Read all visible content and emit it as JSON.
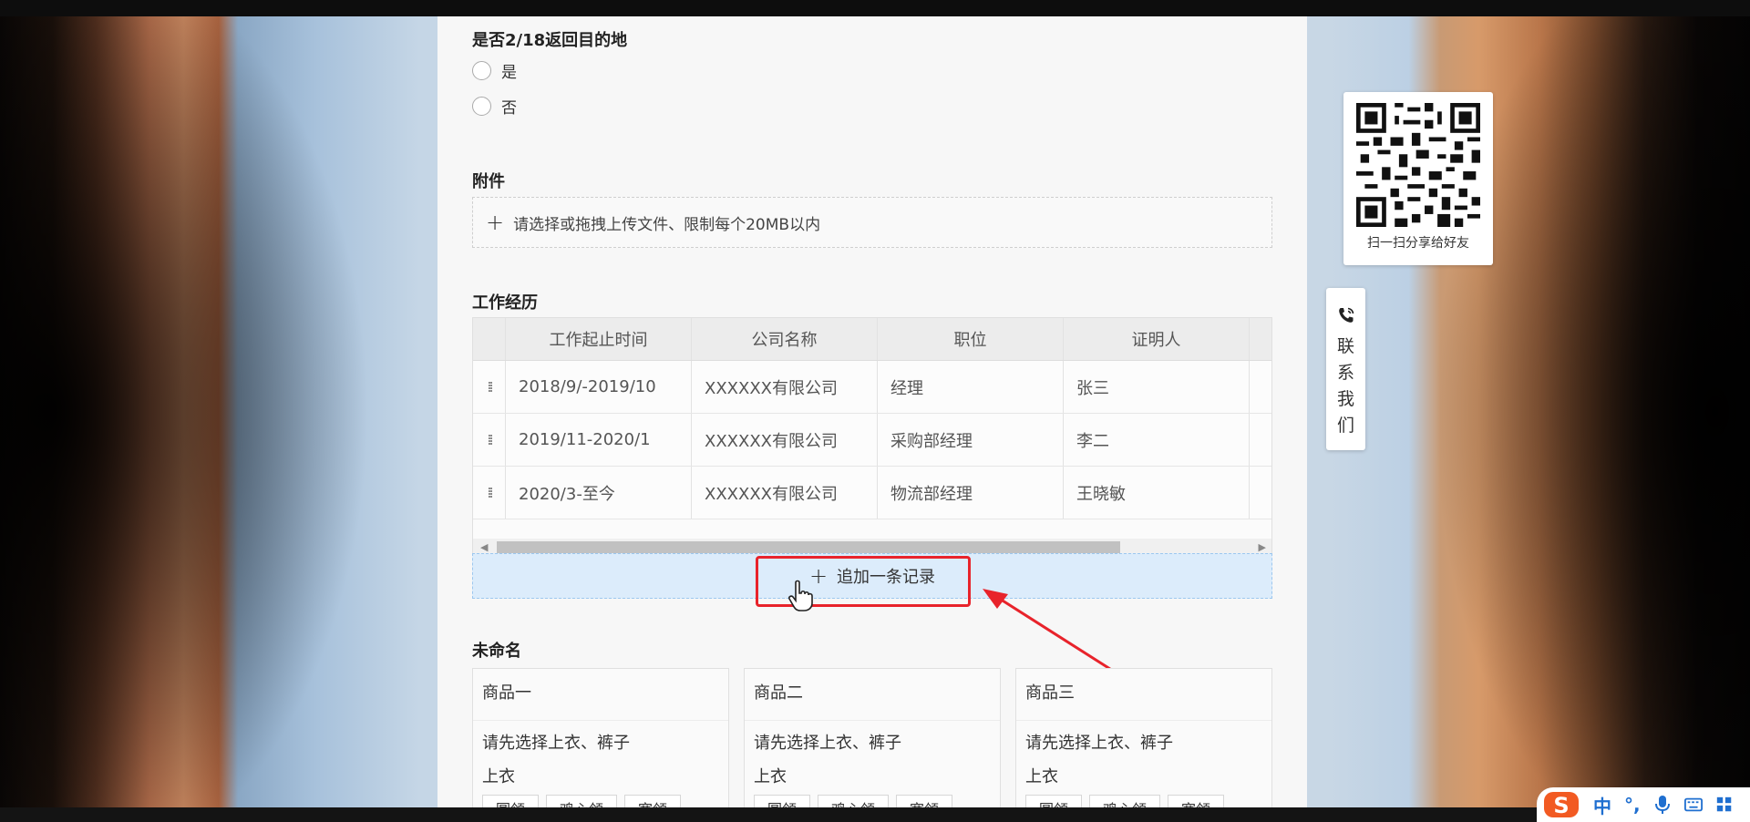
{
  "form": {
    "question_title": "是否2/18返回目的地",
    "options": [
      "是",
      "否"
    ],
    "attachment": {
      "title": "附件",
      "upload_hint": "请选择或拖拽上传文件、限制每个20MB以内"
    },
    "work_history": {
      "title": "工作经历",
      "columns": [
        "工作起止时间",
        "公司名称",
        "职位",
        "证明人"
      ],
      "rows": [
        [
          "2018/9/-2019/10",
          "XXXXXX有限公司",
          "经理",
          "张三"
        ],
        [
          "2019/11-2020/1",
          "XXXXXX有限公司",
          "采购部经理",
          "李二"
        ],
        [
          "2020/3-至今",
          "XXXXXX有限公司",
          "物流部经理",
          "王晓敏"
        ]
      ],
      "add_record_label": "追加一条记录"
    },
    "unnamed": {
      "title": "未命名",
      "cards": [
        {
          "title": "商品一",
          "hint": "请先选择上衣、裤子",
          "sub": "上衣",
          "chips": [
            "圆领",
            "鸡心领",
            "宽领"
          ]
        },
        {
          "title": "商品二",
          "hint": "请先选择上衣、裤子",
          "sub": "上衣",
          "chips": [
            "圆领",
            "鸡心领",
            "宽领"
          ]
        },
        {
          "title": "商品三",
          "hint": "请先选择上衣、裤子",
          "sub": "上衣",
          "chips": [
            "圆领",
            "鸡心领",
            "宽领"
          ]
        }
      ]
    }
  },
  "side": {
    "qr_caption": "扫一扫分享给好友",
    "contact_label": "联\n系\n我\n们"
  },
  "ime": {
    "logo_icon": "sogou-s-icon",
    "mode": "中",
    "punct": "°,",
    "voice_icon": "mic-icon",
    "keyboard_icon": "keyboard-icon",
    "toolbox_icon": "grid-icon"
  },
  "colors": {
    "highlight": "#e8232b",
    "add_record_bg": "#dcecfb",
    "ime_blue": "#1f6fd0"
  }
}
